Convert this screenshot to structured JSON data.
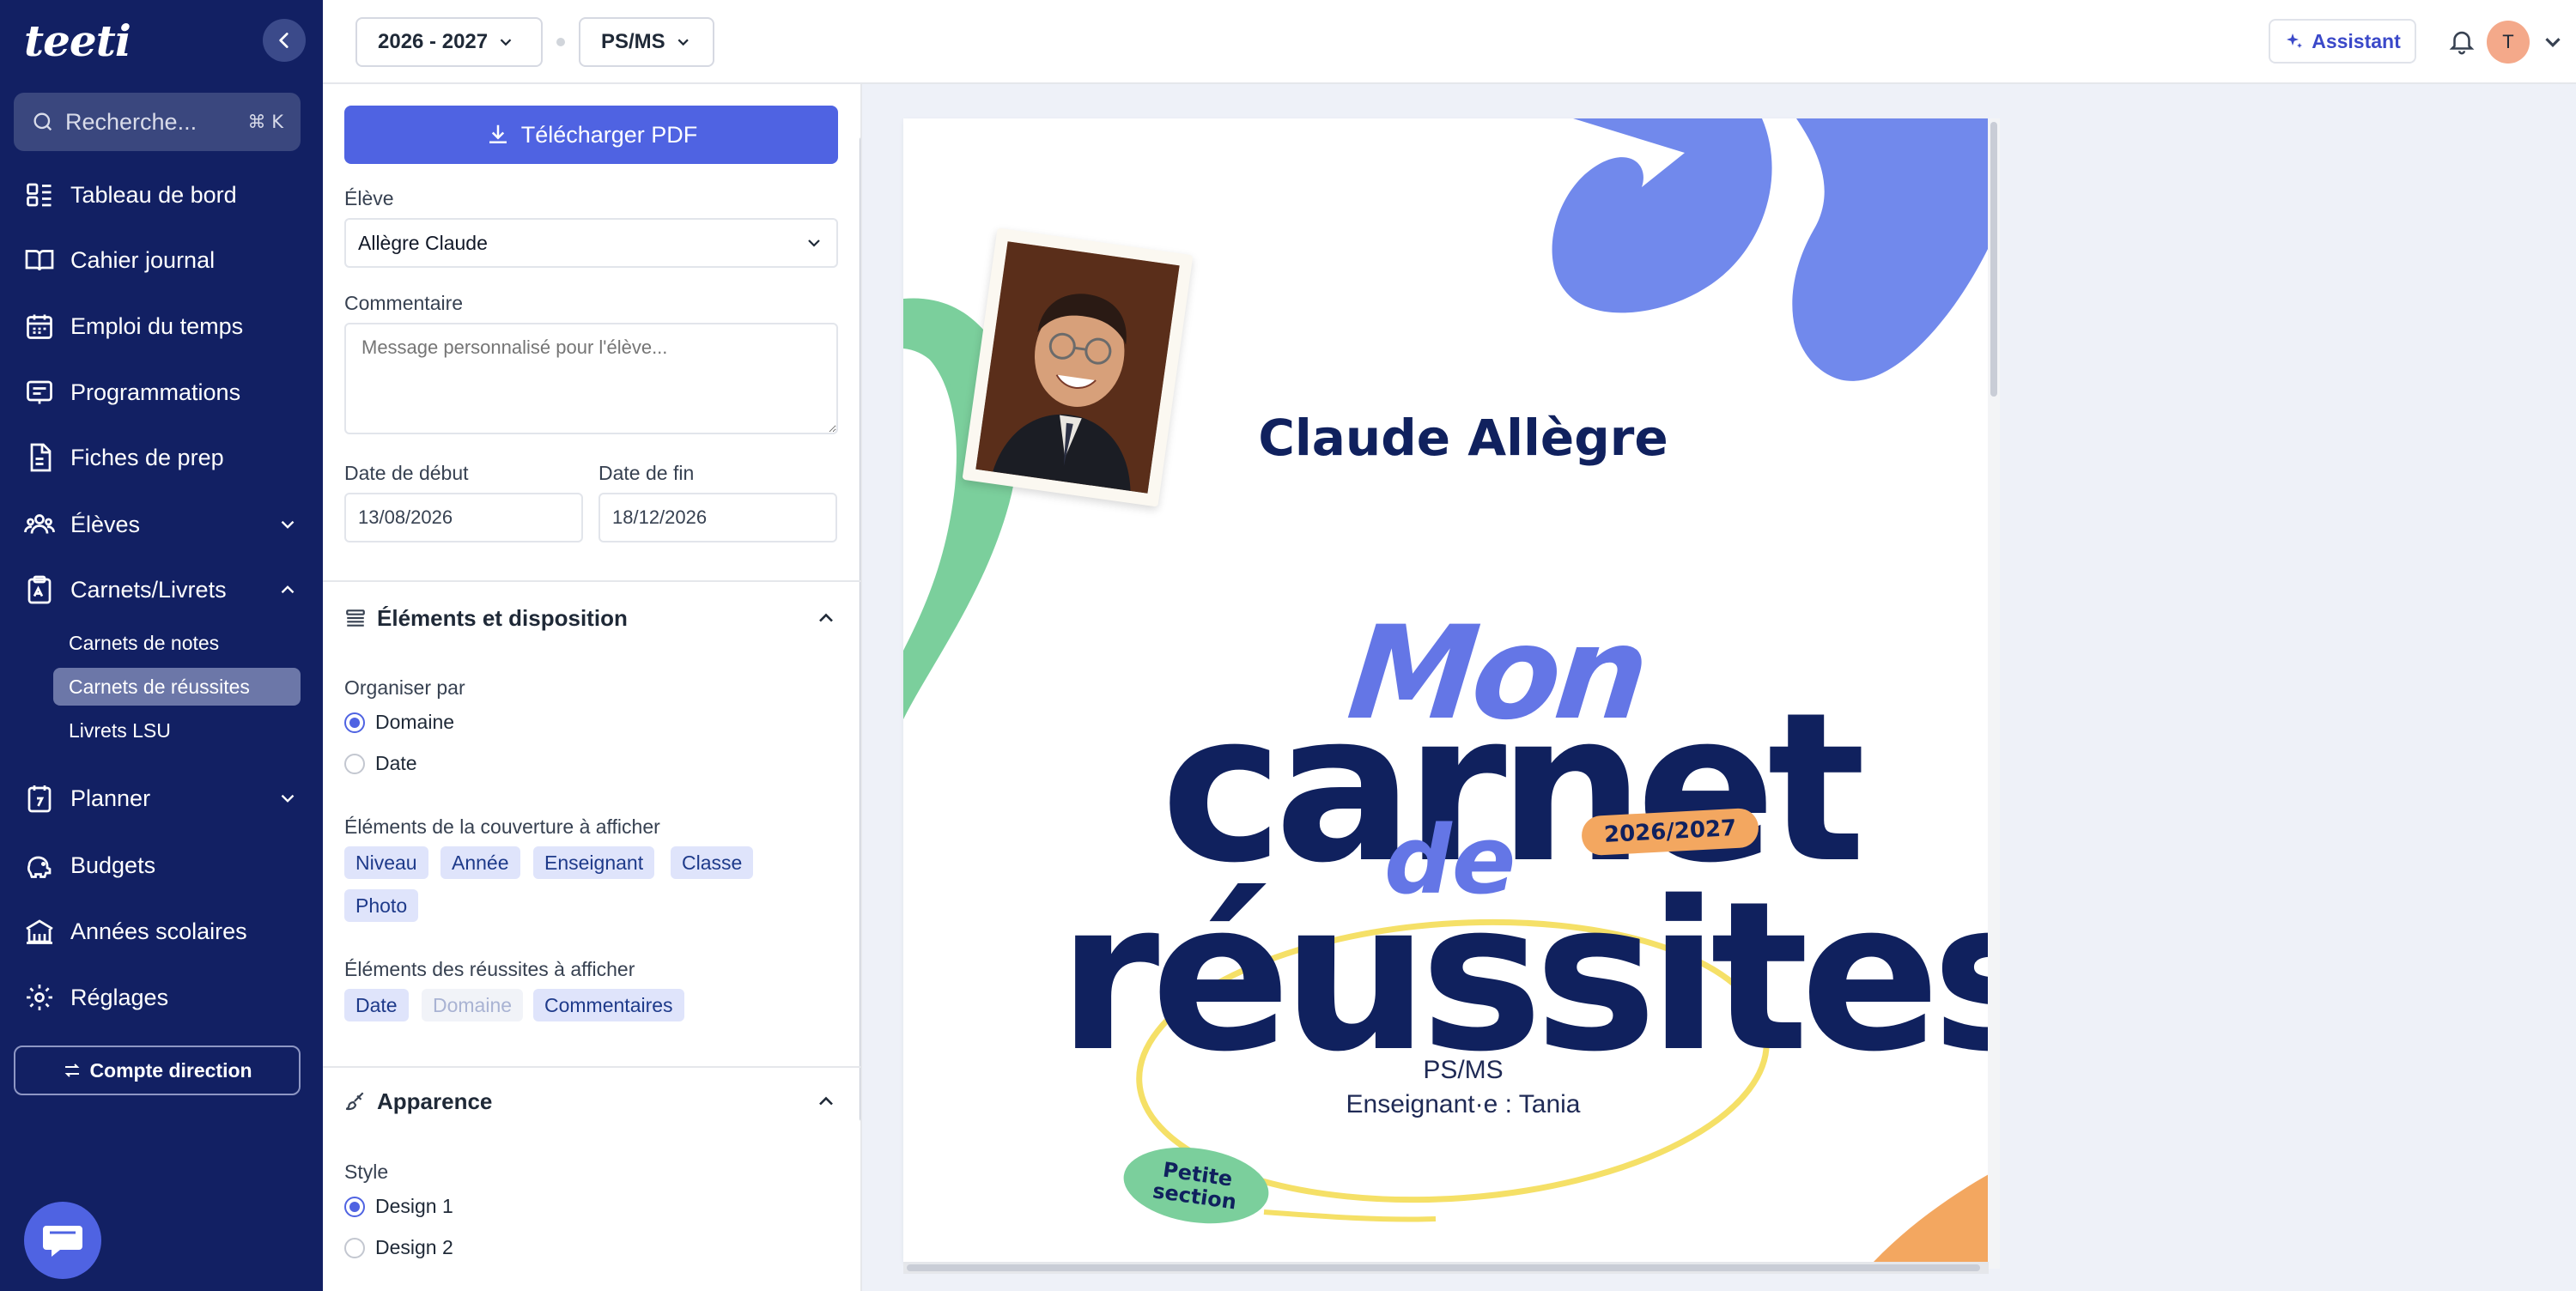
{
  "sidebar": {
    "logo": "teeti",
    "search": {
      "placeholder": "Recherche...",
      "shortcut": "⌘ K"
    },
    "items": [
      {
        "label": "Tableau de bord"
      },
      {
        "label": "Cahier journal"
      },
      {
        "label": "Emploi du temps"
      },
      {
        "label": "Programmations"
      },
      {
        "label": "Fiches de prep"
      },
      {
        "label": "Élèves"
      },
      {
        "label": "Carnets/Livrets"
      },
      {
        "label": "Planner"
      },
      {
        "label": "Budgets"
      },
      {
        "label": "Années scolaires"
      },
      {
        "label": "Réglages"
      }
    ],
    "subitems": [
      {
        "label": "Carnets de notes"
      },
      {
        "label": "Carnets de réussites"
      },
      {
        "label": "Livrets LSU"
      }
    ],
    "direction_button": "Compte direction"
  },
  "topbar": {
    "year_select": "2026 - 2027",
    "class_select": "PS/MS",
    "assistant_label": "Assistant",
    "avatar_initial": "T"
  },
  "panel": {
    "download_button": "Télécharger PDF",
    "student_label": "Élève",
    "student_value": "Allègre Claude",
    "comment_label": "Commentaire",
    "comment_placeholder": "Message personnalisé pour l'élève...",
    "start_date_label": "Date de début",
    "start_date_value": "13/08/2026",
    "end_date_label": "Date de fin",
    "end_date_value": "18/12/2026",
    "section_layout": {
      "title": "Éléments et disposition",
      "organize_label": "Organiser par",
      "organize_options": [
        "Domaine",
        "Date"
      ],
      "organize_selected": "Domaine",
      "cover_label": "Éléments de la couverture à afficher",
      "cover_chips": [
        "Niveau",
        "Année",
        "Enseignant",
        "Classe",
        "Photo"
      ],
      "success_label": "Éléments des réussites à afficher",
      "success_chips": [
        "Date",
        "Domaine",
        "Commentaires"
      ],
      "success_chips_disabled": [
        "Domaine"
      ]
    },
    "section_appearance": {
      "title": "Apparence",
      "style_label": "Style",
      "style_options": [
        "Design 1",
        "Design 2"
      ],
      "style_selected": "Design 1"
    }
  },
  "preview": {
    "student_name": "Claude Allègre",
    "title_mon": "Mon",
    "title_carnet": "carnet",
    "title_de": "de",
    "title_reussites": "réussites",
    "year_badge": "2026/2027",
    "class_line": "PS/MS",
    "teacher_line": "Enseignant·e : Tania",
    "level_badge_line1": "Petite",
    "level_badge_line2": "section",
    "colors": {
      "navy": "#10215e",
      "periwinkle": "#6476e6",
      "green": "#7bcf9c",
      "orange": "#f3a760",
      "yellow": "#f5e067"
    }
  },
  "colors": {
    "sidebar_bg": "#122063",
    "accent": "#4f63e2",
    "chip_bg": "#dfe4fb"
  }
}
